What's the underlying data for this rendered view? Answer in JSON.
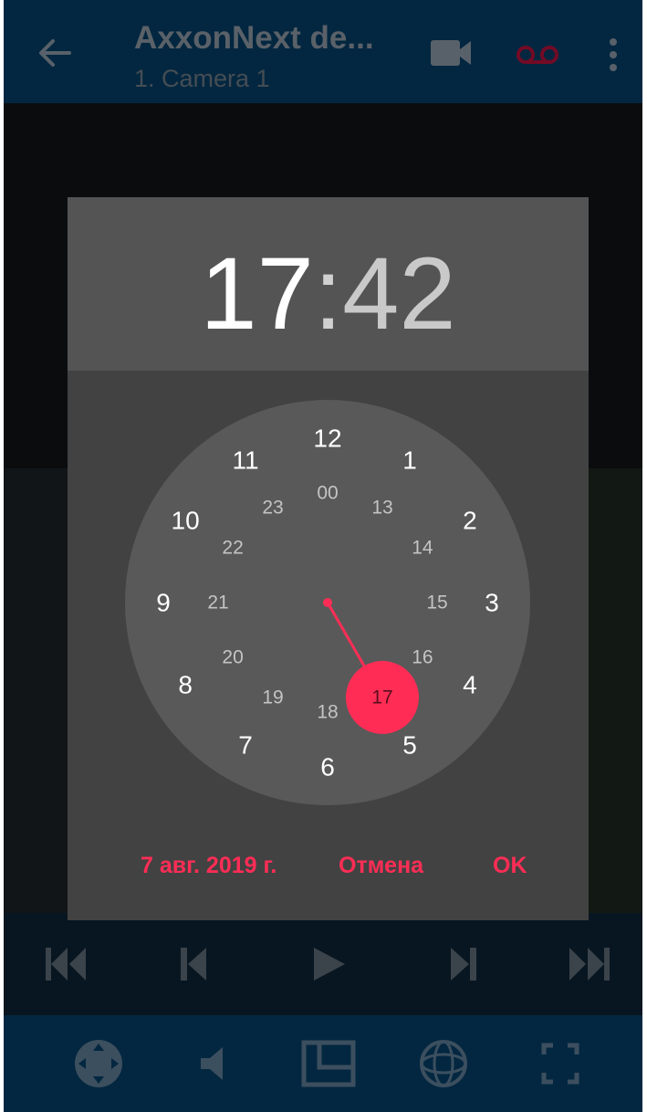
{
  "app": {
    "title": "AxxonNext de...",
    "subtitle": "1. Camera 1"
  },
  "icons": {
    "back": "arrow-left-icon",
    "camera": "video-camera-icon",
    "record": "voicemail-record-icon",
    "more": "more-vertical-icon",
    "first": "skip-to-start-icon",
    "prev": "step-back-icon",
    "play": "play-icon",
    "next": "step-forward-icon",
    "last": "skip-to-end-icon",
    "ptz": "ptz-joystick-icon",
    "sound": "speaker-icon",
    "layout": "layout-icon",
    "fisheye": "fisheye-icon",
    "fullscreen": "fullscreen-icon"
  },
  "colors": {
    "accent": "#ff2d55",
    "appbar": "#063c63",
    "dialog": "#424242",
    "clock_face": "#595959"
  },
  "time_picker": {
    "hours": "17",
    "separator": ":",
    "minutes": "42",
    "outer_numbers": [
      "12",
      "1",
      "2",
      "3",
      "4",
      "5",
      "6",
      "7",
      "8",
      "9",
      "10",
      "11"
    ],
    "inner_numbers": [
      "00",
      "13",
      "14",
      "15",
      "16",
      "17",
      "18",
      "19",
      "20",
      "21",
      "22",
      "23"
    ],
    "selected_hour": "17"
  },
  "actions": {
    "date": "7 авг. 2019 г.",
    "cancel": "Отмена",
    "ok": "OK"
  }
}
